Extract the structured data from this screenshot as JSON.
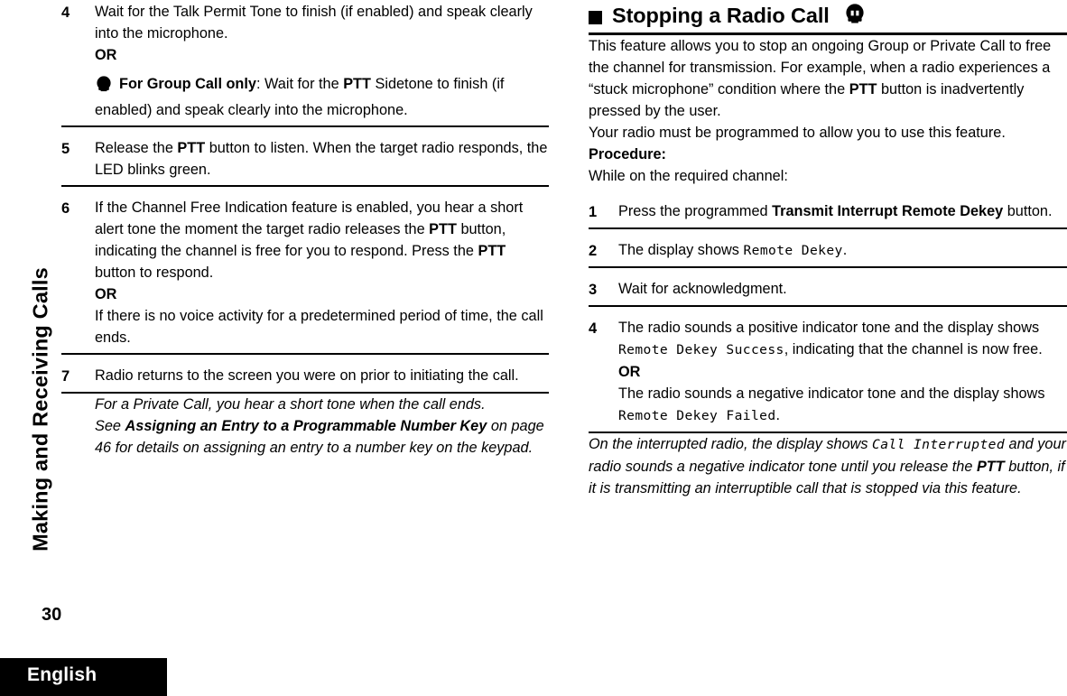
{
  "page": {
    "number": "30",
    "chapter_tab": "Making and Receiving Calls",
    "footer_language": "English"
  },
  "left_column": {
    "steps": [
      {
        "number": "4",
        "lines": [
          "Wait for the Talk Permit Tone to finish (if enabled) and speak clearly into the microphone.",
          "OR"
        ],
        "or_label": "OR",
        "note_icon": "radio-solid-icon",
        "note_bold_lead": "For Group Call only",
        "note_rest_a": ": Wait for the ",
        "note_bold_ptt": "PTT",
        "note_rest_b": " Sidetone to finish (if enabled) and speak clearly into the microphone."
      },
      {
        "number": "5",
        "text_a": "Release the ",
        "bold_ptt": "PTT",
        "text_b": " button to listen. When the target radio responds, the LED blinks green."
      },
      {
        "number": "6",
        "text_a": "If the Channel Free Indication feature is enabled, you hear a short alert tone the moment the target radio releases the ",
        "bold_ptt_1": "PTT",
        "text_b": " button, indicating the channel is free for you to respond. Press the ",
        "bold_ptt_2": "PTT",
        "text_c": " button to respond.",
        "or_label": "OR",
        "text_d": "If there is no voice activity for a predetermined period of time, the call ends."
      },
      {
        "number": "7",
        "text": "Radio returns to the screen you were on prior to initiating the call."
      }
    ],
    "notes": [
      {
        "text": "For a Private Call, you hear a short tone when the call ends."
      }
    ],
    "cross_reference": {
      "lead": "See ",
      "bold_title": "Assigning an Entry to a Programmable Number Key",
      "tail": " on page 46 for details on assigning an entry to a number key on the keypad."
    }
  },
  "right_column": {
    "heading": {
      "title": "Stopping a Radio Call",
      "bullet_icon": "filled-square-icon",
      "trailing_icon": "radio-outline-icon"
    },
    "intro_a": "This feature allows you to stop an ongoing Group or Private Call to free the channel for transmission. For example, when a radio experiences a “stuck microphone” condition where the ",
    "intro_bold_ptt": "PTT",
    "intro_b": " button is inadvertently pressed by the user.",
    "requirement": "Your radio must be programmed to allow you to use this feature.",
    "procedure_label": "Procedure:",
    "procedure_lead": "While on the required channel:",
    "steps": [
      {
        "number": "1",
        "text_a": "Press the programmed ",
        "bold_name": "Transmit Interrupt Remote Dekey",
        "text_b": " button."
      },
      {
        "number": "2",
        "text_a": "The display shows ",
        "lcd": "Remote Dekey",
        "text_b": "."
      },
      {
        "number": "3",
        "text": "Wait for acknowledgment."
      },
      {
        "number": "4",
        "text_a": "The radio sounds a positive indicator tone and the display shows ",
        "lcd_1": "Remote Dekey Success",
        "text_b": ", indicating that the channel is now free.",
        "or_label": "OR",
        "text_c": "The radio sounds a negative indicator tone and the display shows ",
        "lcd_2": "Remote Dekey Failed",
        "text_d": "."
      }
    ],
    "closing_note": {
      "text_a": "On the interrupted radio, the display shows ",
      "lcd": "Call Interrupted",
      "text_b": " and your radio sounds a negative indicator tone until you release the ",
      "bold_ptt": "PTT",
      "text_c": " button, if it is transmitting an interruptible call that is stopped via this feature."
    }
  },
  "colors": {
    "text": "#000000",
    "background": "#ffffff",
    "footer_bar": "#000000",
    "footer_text": "#ffffff"
  }
}
